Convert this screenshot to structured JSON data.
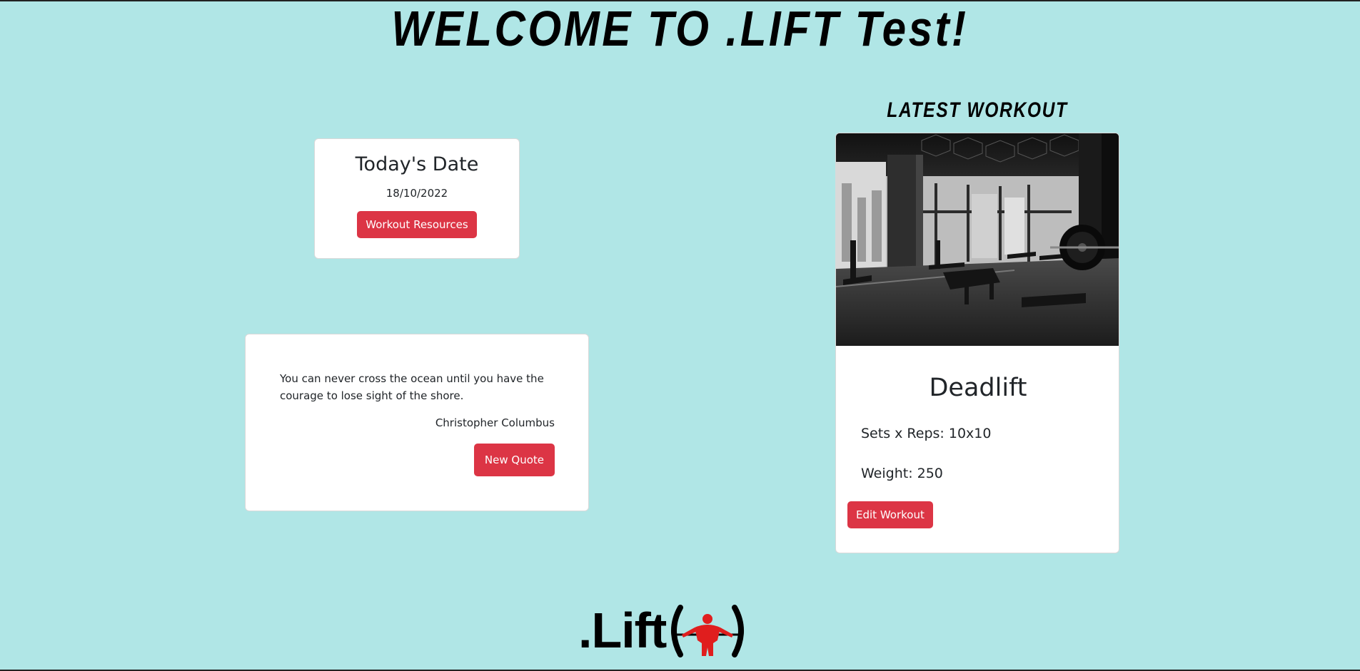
{
  "header": {
    "title": "WELCOME TO .LIFT Test!"
  },
  "date_card": {
    "title": "Today's Date",
    "date": "18/10/2022",
    "button_label": "Workout Resources"
  },
  "quote_card": {
    "quote": "You can never cross the ocean until you have the courage to lose sight of the shore.",
    "author": "Christopher Columbus",
    "button_label": "New Quote"
  },
  "latest_workout": {
    "heading": "LATEST WORKOUT",
    "image_alt": "gym-interior-photo",
    "exercise": "Deadlift",
    "sets_reps": "Sets x Reps: 10x10",
    "weight": "Weight: 250",
    "button_label": "Edit Workout"
  },
  "footer": {
    "logo_text": ".Lift"
  },
  "colors": {
    "background": "#b0e6e6",
    "accent": "#dc3545",
    "card": "#ffffff"
  }
}
